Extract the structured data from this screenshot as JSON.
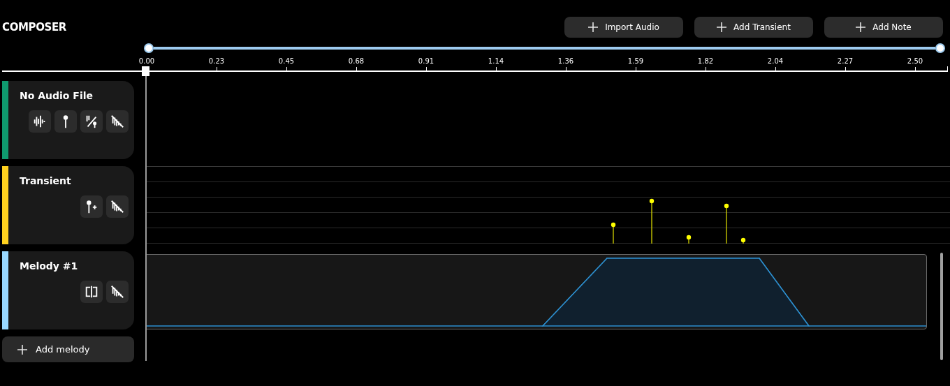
{
  "title": "COMPOSER",
  "actions": [
    {
      "label": "Import Audio"
    },
    {
      "label": "Add Transient"
    },
    {
      "label": "Add Note"
    }
  ],
  "range": {
    "level": 1
  },
  "ruler": {
    "ticks": [
      "0.00",
      "0.23",
      "0.45",
      "0.68",
      "0.91",
      "1.14",
      "1.36",
      "1.59",
      "1.82",
      "2.04",
      "2.27",
      "2.50"
    ]
  },
  "tracks": [
    {
      "name": "No Audio File",
      "kind": "audio",
      "color": "#0f9a6e",
      "tools": [
        {
          "kind": "waveform"
        },
        {
          "kind": "pin"
        },
        {
          "kind": "pin-slash"
        },
        {
          "kind": "mute"
        }
      ]
    },
    {
      "name": "Transient",
      "kind": "transient",
      "color": "#ffd21f",
      "tools": [
        {
          "kind": "pin-plus"
        },
        {
          "kind": "mute"
        }
      ]
    },
    {
      "name": "Melody #1",
      "kind": "melody",
      "color": "#99d8ff",
      "tools": [
        {
          "kind": "split"
        },
        {
          "kind": "mute"
        }
      ]
    }
  ],
  "add_melody": {
    "label": "Add melody"
  }
}
